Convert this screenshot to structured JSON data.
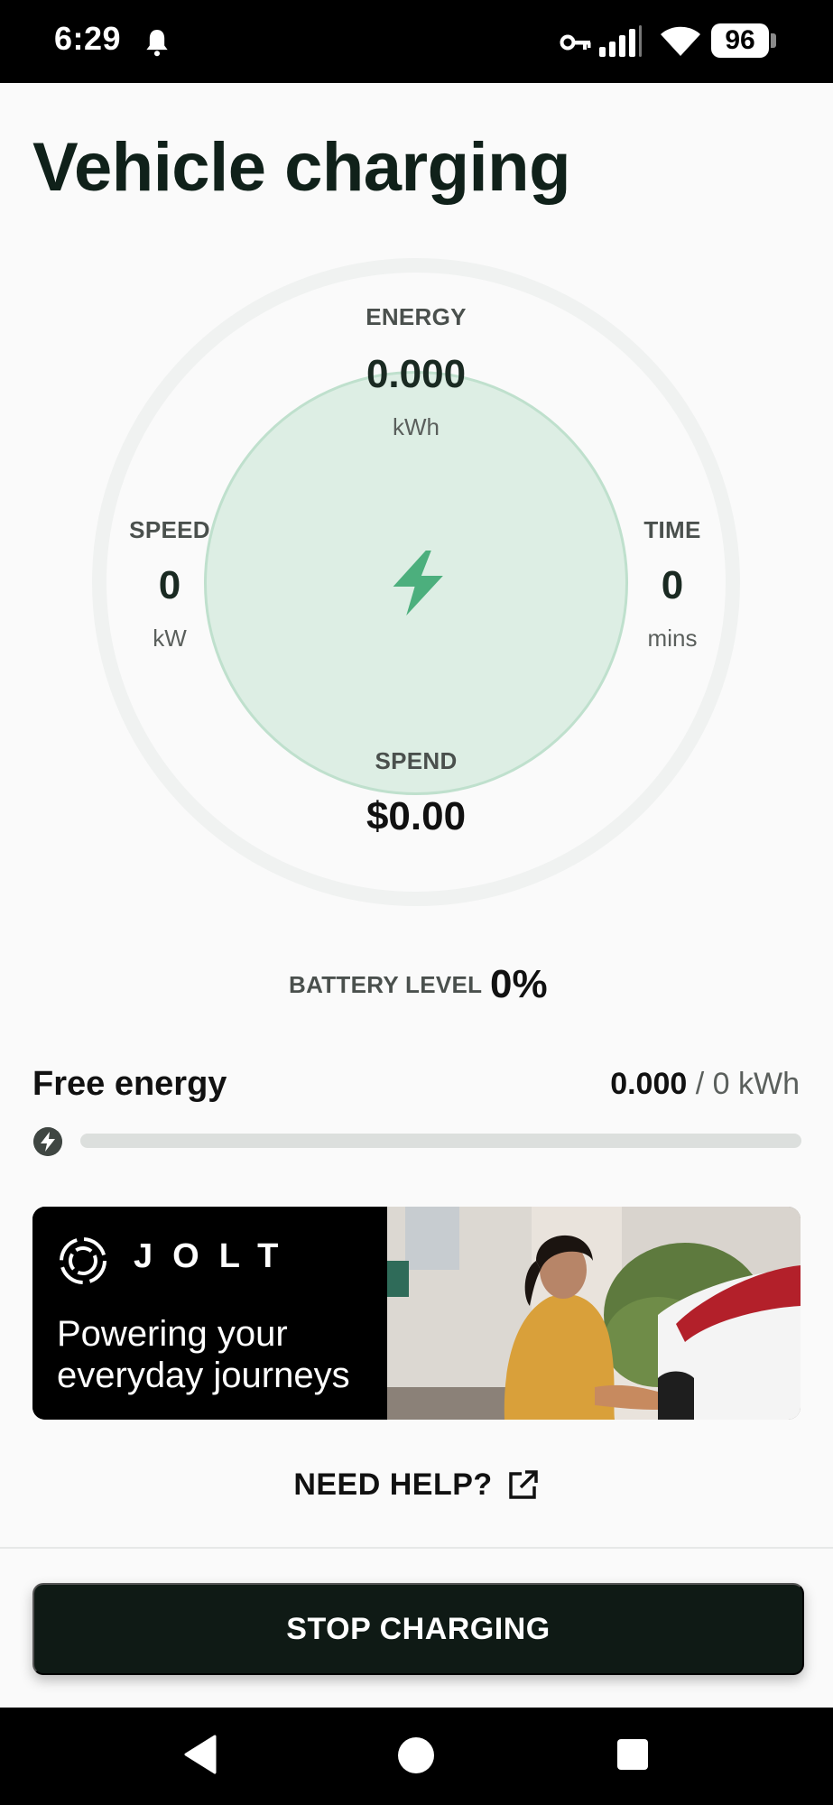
{
  "status_bar": {
    "time": "6:29",
    "battery_percent": "96"
  },
  "page": {
    "title": "Vehicle charging"
  },
  "gauge": {
    "energy": {
      "label": "ENERGY",
      "value": "0.000",
      "unit": "kWh"
    },
    "speed": {
      "label": "SPEED",
      "value": "0",
      "unit": "kW"
    },
    "time": {
      "label": "TIME",
      "value": "0",
      "unit": "mins"
    },
    "spend": {
      "label": "SPEND",
      "value": "$0.00"
    },
    "center_icon": "lightning-bolt-icon"
  },
  "battery": {
    "label": "BATTERY LEVEL",
    "value": "0%"
  },
  "free_energy": {
    "title": "Free energy",
    "used": "0.000",
    "total": "/ 0 kWh",
    "progress_fraction": 0
  },
  "banner": {
    "brand": "JOLT",
    "tagline_line1": "Powering your",
    "tagline_line2": "everyday journeys"
  },
  "help": {
    "label": "NEED HELP?"
  },
  "actions": {
    "stop_label": "STOP CHARGING"
  },
  "colors": {
    "accent_green": "#4caf7d",
    "gauge_fill": "#ddeee4",
    "button_dark": "#0f1a15"
  }
}
